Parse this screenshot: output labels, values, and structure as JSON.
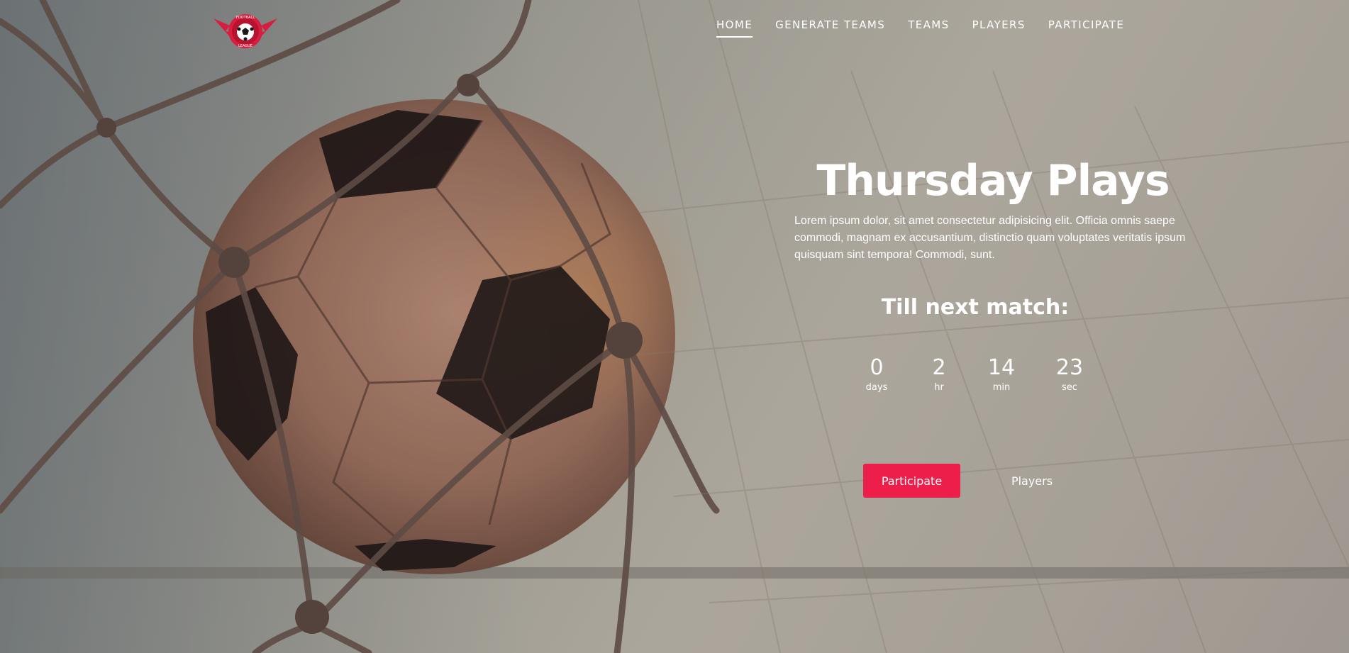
{
  "brand": {
    "logo_top_text": "FOOTBALL",
    "logo_bottom_text": "LEAGUE",
    "accent_color": "#ee1e4a"
  },
  "nav": {
    "items": [
      {
        "label": "HOME",
        "active": true
      },
      {
        "label": "GENERATE TEAMS",
        "active": false
      },
      {
        "label": "TEAMS",
        "active": false
      },
      {
        "label": "PLAYERS",
        "active": false
      },
      {
        "label": "PARTICIPATE",
        "active": false
      }
    ]
  },
  "hero": {
    "title": "Thursday Plays",
    "description": "Lorem ipsum dolor, sit amet consectetur adipisicing elit. Officia omnis saepe commodi, magnam ex accusantium, distinctio quam voluptates veritatis ipsum quisquam sint tempora! Commodi, sunt.",
    "countdown_title": "Till next match:",
    "countdown": [
      {
        "value": "0",
        "label": "days"
      },
      {
        "value": "2",
        "label": "hr"
      },
      {
        "value": "14",
        "label": "min"
      },
      {
        "value": "23",
        "label": "sec"
      }
    ],
    "primary_button": "Participate",
    "secondary_button": "Players"
  }
}
